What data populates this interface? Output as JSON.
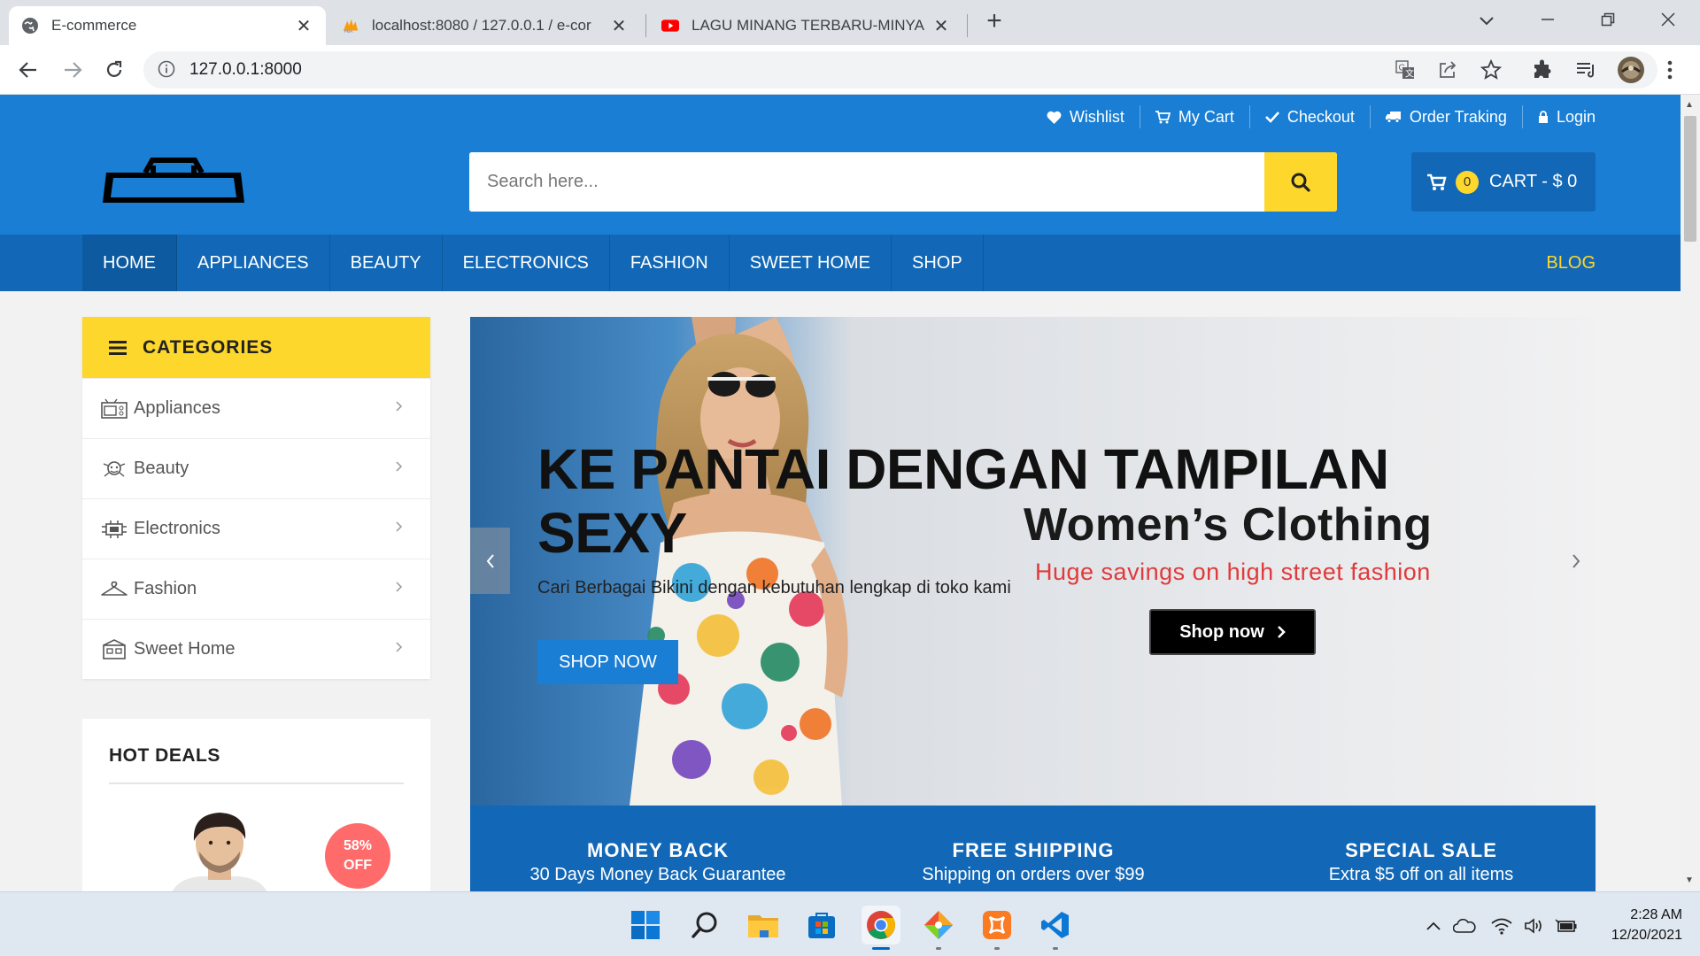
{
  "browser": {
    "tabs": [
      {
        "title": "E-commerce",
        "active": true
      },
      {
        "title": "localhost:8080 / 127.0.0.1 / e-cor",
        "active": false
      },
      {
        "title": "LAGU MINANG TERBARU-MINYA",
        "active": false
      }
    ],
    "url": "127.0.0.1:8000"
  },
  "header": {
    "top_links": [
      "Wishlist",
      "My Cart",
      "Checkout",
      "Order Traking",
      "Login"
    ],
    "search_placeholder": "Search here...",
    "cart_count": "0",
    "cart_label": "CART - $ 0"
  },
  "nav": {
    "items": [
      "HOME",
      "APPLIANCES",
      "BEAUTY",
      "ELECTRONICS",
      "FASHION",
      "SWEET HOME",
      "SHOP"
    ],
    "active_index": 0,
    "blog": "BLOG"
  },
  "categories": {
    "title": "CATEGORIES",
    "items": [
      "Appliances",
      "Beauty",
      "Electronics",
      "Fashion",
      "Sweet Home"
    ]
  },
  "hot_deals": {
    "title": "HOT DEALS",
    "discount": "58%",
    "discount_suffix": "OFF"
  },
  "slider": {
    "headline": "KE PANTAI DENGAN TAMPILAN SEXY",
    "subtitle": "Cari Berbagai Bikini dengan kebutuhan lengkap di toko kami",
    "button": "SHOP NOW",
    "banner_title": "Women’s Clothing",
    "banner_subtitle": "Huge savings on high street fashion",
    "banner_button": "Shop now"
  },
  "features": [
    {
      "title": "MONEY BACK",
      "subtitle": "30 Days Money Back Guarantee"
    },
    {
      "title": "FREE SHIPPING",
      "subtitle": "Shipping on orders over $99"
    },
    {
      "title": "SPECIAL SALE",
      "subtitle": "Extra $5 off on all items"
    }
  ],
  "taskbar": {
    "time": "2:28 AM",
    "date": "12/20/2021"
  },
  "colors": {
    "brand_blue": "#1a7ed4",
    "nav_blue": "#1268b7",
    "accent_yellow": "#fed72c",
    "badge_red": "#ff6b6b"
  }
}
